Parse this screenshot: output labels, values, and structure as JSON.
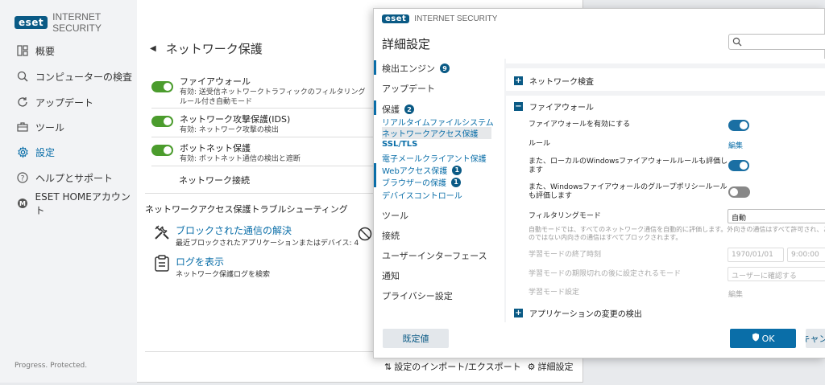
{
  "main": {
    "logo": "eset",
    "product": "INTERNET SECURITY",
    "nav": [
      {
        "label": "概要",
        "icon": "dashboard-icon"
      },
      {
        "label": "コンピューターの検査",
        "icon": "search-icon"
      },
      {
        "label": "アップデート",
        "icon": "refresh-icon"
      },
      {
        "label": "ツール",
        "icon": "briefcase-icon"
      },
      {
        "label": "設定",
        "icon": "gear-icon",
        "active": true
      },
      {
        "label": "ヘルプとサポート",
        "icon": "help-icon"
      },
      {
        "label": "ESET HOMEアカウント",
        "icon": "eset-home-icon"
      }
    ],
    "status": "Progress. Protected.",
    "page_title": "ネットワーク保護",
    "features": [
      {
        "title": "ファイアウォール",
        "sub1": "有効: 送受信ネットワークトラフィックのフィルタリング",
        "sub2": "ルール付き自動モード"
      },
      {
        "title": "ネットワーク攻撃保護(IDS)",
        "sub1": "有効: ネットワーク攻撃の検出"
      },
      {
        "title": "ボットネット保護",
        "sub1": "有効: ボットネット通信の検出と遮断"
      }
    ],
    "network_connections": "ネットワーク接続",
    "troubleshoot_heading": "ネットワークアクセス保護トラブルシューティング",
    "tools": [
      {
        "title": "ブロックされた通信の解決",
        "sub": "最近ブロックされたアプリケーションまたはデバイス: 4"
      },
      {
        "title": "ログを表示",
        "sub": "ネットワーク保護ログを検索"
      }
    ]
  },
  "dialog": {
    "logo": "eset",
    "product": "INTERNET SECURITY",
    "title": "詳細設定",
    "nav": {
      "detection_engine": "検出エンジン",
      "detection_badge": "9",
      "update": "アップデート",
      "protection": "保護",
      "protection_badge": "2",
      "realtime": "リアルタイムファイルシステム保護",
      "network_access": "ネットワークアクセス保護",
      "ssl": "SSL/TLS",
      "email": "電子メールクライアント保護",
      "web": "Webアクセス保護",
      "web_badge": "1",
      "browser": "ブラウザーの保護",
      "browser_badge": "1",
      "device": "デバイスコントロール",
      "tools": "ツール",
      "connectivity": "接続",
      "ui": "ユーザーインターフェース",
      "notifications": "通知",
      "privacy": "プライバシー設定"
    },
    "sections": {
      "network_inspection": "ネットワーク検査",
      "firewall": "ファイアウォール",
      "app_change": "アプリケーションの変更の検出"
    },
    "settings": {
      "enable_firewall": "ファイアウォールを有効にする",
      "rules": "ルール",
      "rules_value": "編集",
      "local_rules_1": "また、ローカルのWindowsファイアウォールルールも評価し",
      "local_rules_2": "ます",
      "group_policy_1": "また、Windowsファイアウォールのグループポリシールール",
      "group_policy_2": "も評価します",
      "filtering_mode": "フィルタリングモード",
      "filtering_value": "自動",
      "desc_1": "自動モードでは、すべてのネットワーク通信を自動的に評価します。外向きの通信はすべて許可され、このコンピューターから",
      "desc_2": "のではない内向きの通信はすべてブロックされます。",
      "learning_end": "学習モードの終了時刻",
      "learning_date": "1970/01/01",
      "learning_time": "9:00:00",
      "learning_after": "学習モードの期限切れの後に設定されるモード",
      "learning_after_value": "ユーザーに確認する",
      "learning_settings": "学習モード設定",
      "learning_settings_value": "編集"
    },
    "footer": {
      "default": "既定値",
      "ok": "OK",
      "cancel": "キャンセル"
    }
  },
  "bottom_links": {
    "import_export": "設定のインポート/エクスポート",
    "advanced": "詳細設定"
  },
  "colors": {
    "accent": "#0a6ea8",
    "toggle_green": "#4b9c2d",
    "logo_bg": "#0a5a85"
  }
}
